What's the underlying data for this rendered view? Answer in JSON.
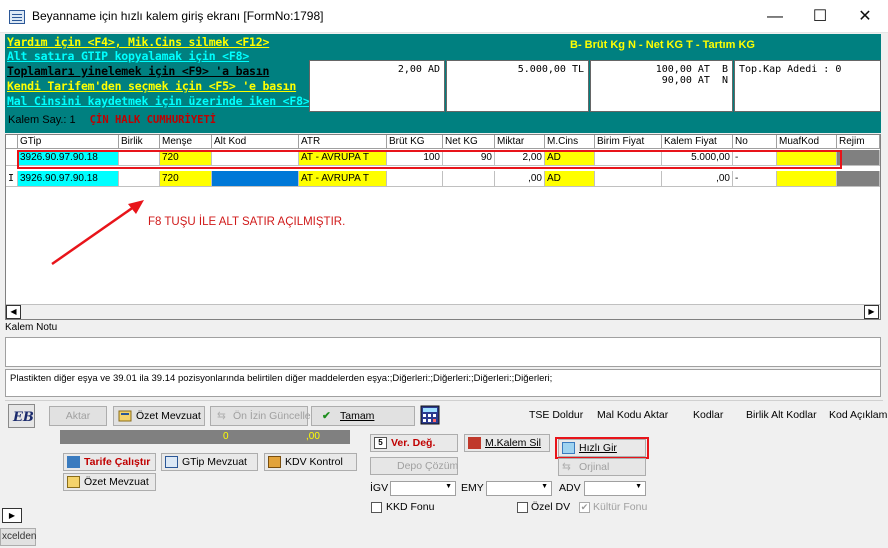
{
  "window": {
    "title": "Beyanname için hızlı kalem giriş ekranı [FormNo:1798]",
    "minimize": "—",
    "maximize": "☐",
    "close": "✕"
  },
  "help": {
    "line1": "Yardım için <F4>, Mik.Cins silmek <F12>",
    "line2": "Alt satıra GTIP kopyalamak için <F8>",
    "line3": "Toplamları yinelemek için <F9> 'a basın",
    "line4": "Kendi Tarifem'den seçmek için <F5> 'e basın",
    "line5": "Mal Cinsini kaydetmek için üzerinde iken <F8>",
    "legend": "B- Brüt Kg    N - Net KG    T - Tartım KG",
    "kalem_say_label": "Kalem Say.: 1",
    "country": "ÇİN HALK CUMHURİYETİ"
  },
  "summary": {
    "box1": "2,00 AD",
    "box2": "5.000,00 TL",
    "box3": "100,00 AT  B\n90,00 AT  N",
    "box4": "Top.Kap Adedi : 0"
  },
  "grid": {
    "headers": [
      "GTip",
      "Birlik",
      "Menşe",
      "Alt Kod",
      "ATR",
      "Brüt KG",
      "Net KG",
      "Miktar",
      "M.Cins",
      "Birim Fiyat",
      "Kalem Fiyat",
      "No",
      "MuafKod",
      "Rejim"
    ],
    "rows": [
      {
        "marker": "",
        "gtip": "3926.90.97.90.18",
        "birlik": "",
        "mense": "720",
        "altkod": "",
        "atr": "AT    - AVRUPA T",
        "brut": "100",
        "net": "90",
        "miktar": "2,00",
        "mcins": "AD",
        "birim": "",
        "kalem": "5.000,00",
        "no": "-",
        "muaf": "",
        "rejim": ""
      },
      {
        "marker": "I",
        "gtip": "3926.90.97.90.18",
        "birlik": "",
        "mense": "720",
        "altkod": "",
        "atr": "AT    - AVRUPA T",
        "brut": "",
        "net": "",
        "miktar": ",00",
        "mcins": "AD",
        "birim": "",
        "kalem": ",00",
        "no": "-",
        "muaf": "",
        "rejim": ""
      }
    ]
  },
  "annotation": "F8 TUŞU İLE ALT SATIR AÇILMIŞTIR.",
  "kalem_notu_label": "Kalem Notu",
  "description": "Plastikten diğer eşya ve 39.01 ila 39.14 pozisyonlarında belirtilen diğer maddelerden eşya:;Diğerleri:;Diğerleri:;Diğerleri:;Diğerleri;",
  "toolbar": {
    "aktar": "Aktar",
    "ozet_mevzuat": "Özet Mevzuat",
    "on_izin_guncelle": "Ön İzin Güncelle",
    "tamam": "Tamam",
    "tse_doldur": "TSE Doldur",
    "mal_kodu_aktar": "Mal Kodu Aktar",
    "kodlar": "Kodlar",
    "birlik_alt_kodlar": "Birlik Alt Kodlar",
    "kod_aciklama": "Kod Açıklam"
  },
  "bottom": {
    "dark_val1": "0",
    "dark_val2": ",00",
    "ver_deg": "Ver. Değ.",
    "m_kalem_sil": "M.Kalem Sil",
    "hizli_gir": "Hızlı Gir",
    "tarife_calistir": "Tarife Çalıştır",
    "gtip_mevzuat": "GTip Mevzuat",
    "kdv_kontrol": "KDV Kontrol",
    "depo_cozum": "Depo Çözüm",
    "orjinal": "Orjinal",
    "ozet_mevzuat": "Özet Mevzuat",
    "igv": "İGV",
    "emy": "EMY",
    "adv": "ADV",
    "kkd_fonu": "KKD Fonu",
    "ozel_dv": "Özel DV",
    "kultur_fonu": "Kültür Fonu",
    "excelden": "xcelden"
  }
}
